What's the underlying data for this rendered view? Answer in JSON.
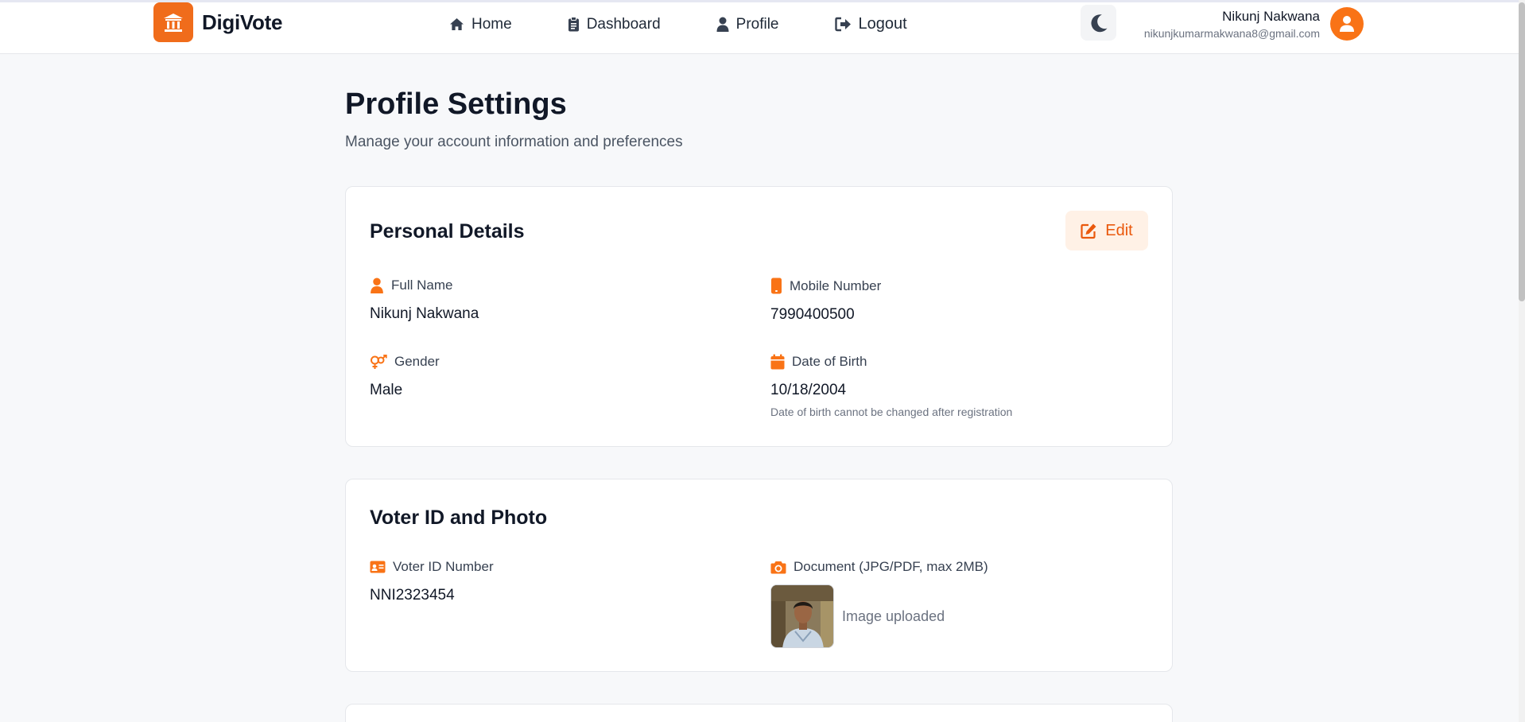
{
  "brand": {
    "name": "DigiVote"
  },
  "nav": {
    "items": [
      {
        "label": "Home",
        "icon": "home-icon"
      },
      {
        "label": "Dashboard",
        "icon": "clipboard-icon"
      },
      {
        "label": "Profile",
        "icon": "user-icon"
      },
      {
        "label": "Logout",
        "icon": "logout-icon"
      }
    ]
  },
  "user": {
    "name": "Nikunj Nakwana",
    "email": "nikunjkumarmakwana8@gmail.com"
  },
  "page": {
    "title": "Profile Settings",
    "subtitle": "Manage your account information and preferences"
  },
  "personal": {
    "title": "Personal Details",
    "edit_label": "Edit",
    "full_name": {
      "label": "Full Name",
      "value": "Nikunj Nakwana"
    },
    "mobile": {
      "label": "Mobile Number",
      "value": "7990400500"
    },
    "gender": {
      "label": "Gender",
      "value": "Male"
    },
    "dob": {
      "label": "Date of Birth",
      "value": "10/18/2004",
      "note": "Date of birth cannot be changed after registration"
    }
  },
  "voter": {
    "title": "Voter ID and Photo",
    "id": {
      "label": "Voter ID Number",
      "value": "NNI2323454"
    },
    "document": {
      "label": "Document (JPG/PDF, max 2MB)",
      "status": "Image uploaded"
    }
  },
  "colors": {
    "accent": "#f97316",
    "accent_dark": "#ea580c",
    "background": "#f7f8fa",
    "card": "#ffffff",
    "text": "#111827"
  }
}
